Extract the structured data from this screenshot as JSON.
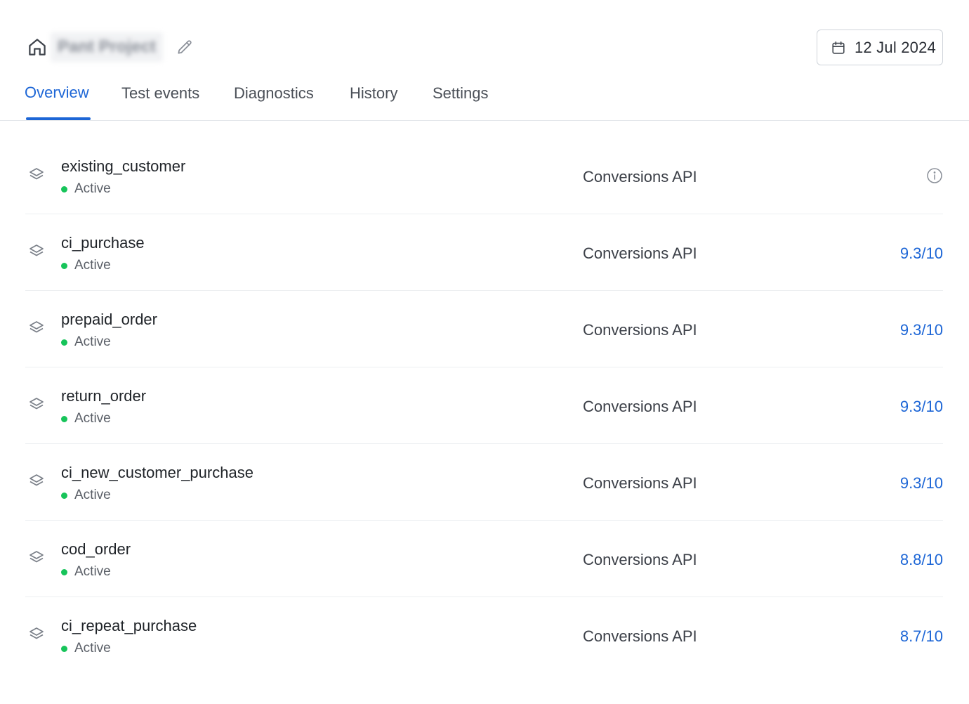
{
  "header": {
    "project_name": "Pant Project",
    "date": "12 Jul 2024"
  },
  "tabs": [
    {
      "label": "Overview",
      "active": true
    },
    {
      "label": "Test events",
      "active": false
    },
    {
      "label": "Diagnostics",
      "active": false
    },
    {
      "label": "History",
      "active": false
    },
    {
      "label": "Settings",
      "active": false
    }
  ],
  "colors": {
    "accent": "#1d66d6",
    "status_active": "#17c45a",
    "divider": "#eceef1"
  },
  "icons": {
    "home": "home-icon",
    "edit": "pencil-icon",
    "date": "calendar-icon",
    "row": "layers-icon",
    "info": "info-icon"
  },
  "events": [
    {
      "name": "existing_customer",
      "status": "Active",
      "source": "Conversions API",
      "score": null
    },
    {
      "name": "ci_purchase",
      "status": "Active",
      "source": "Conversions API",
      "score": "9.3/10"
    },
    {
      "name": "prepaid_order",
      "status": "Active",
      "source": "Conversions API",
      "score": "9.3/10"
    },
    {
      "name": "return_order",
      "status": "Active",
      "source": "Conversions API",
      "score": "9.3/10"
    },
    {
      "name": "ci_new_customer_purchase",
      "status": "Active",
      "source": "Conversions API",
      "score": "9.3/10"
    },
    {
      "name": "cod_order",
      "status": "Active",
      "source": "Conversions API",
      "score": "8.8/10"
    },
    {
      "name": "ci_repeat_purchase",
      "status": "Active",
      "source": "Conversions API",
      "score": "8.7/10"
    }
  ]
}
